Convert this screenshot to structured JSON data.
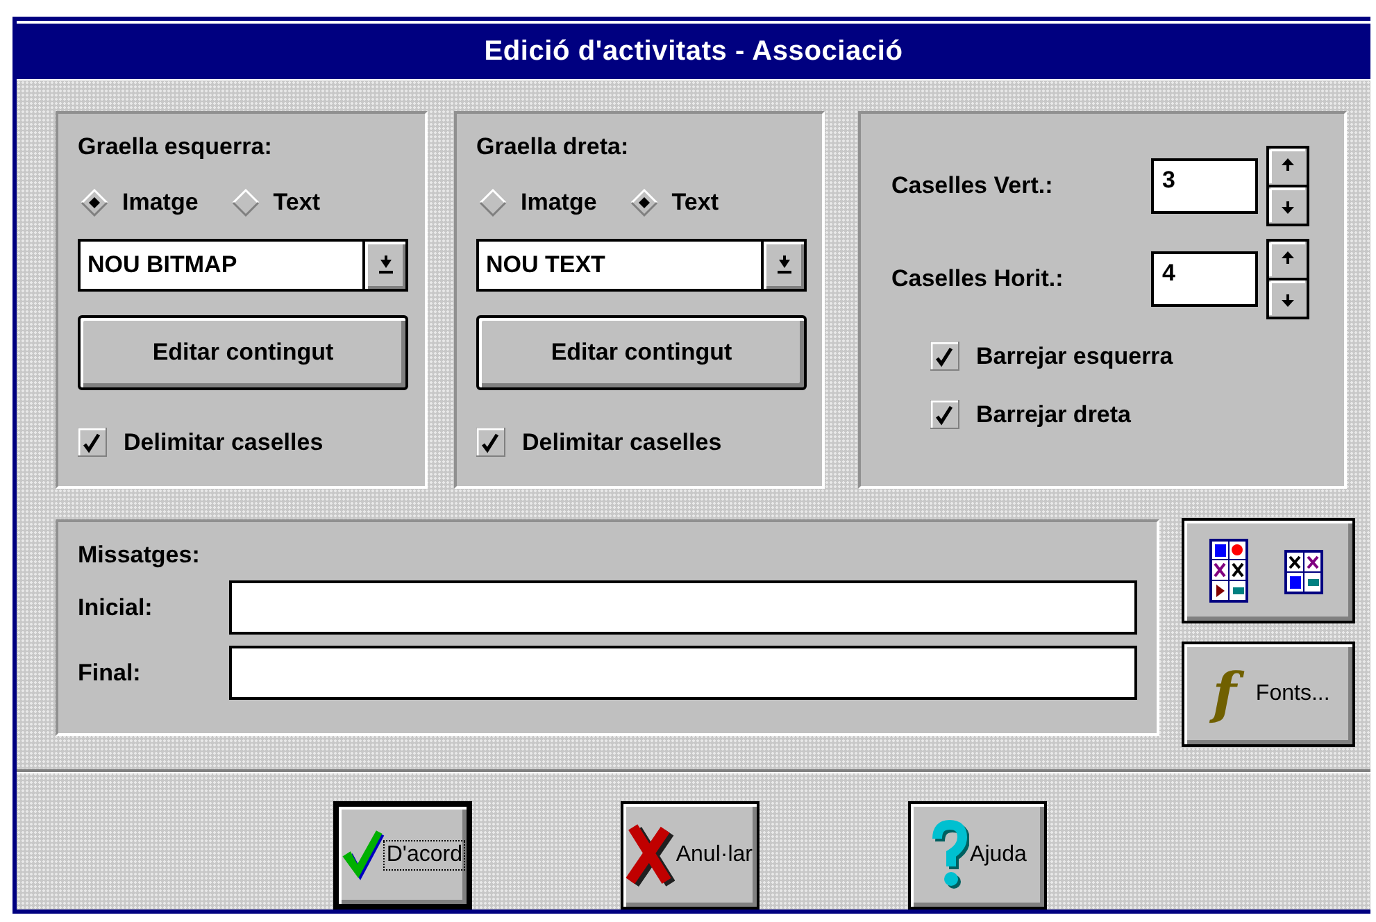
{
  "window": {
    "title": "Edició d'activitats - Associació"
  },
  "grids": [
    {
      "heading": "Graella esquerra:",
      "options": [
        {
          "label": "Imatge",
          "selected": true
        },
        {
          "label": "Text",
          "selected": false
        }
      ],
      "combo": {
        "value": "NOU BITMAP"
      },
      "edit_button": "Editar contingut",
      "delimit": {
        "label": "Delimitar caselles",
        "checked": true
      }
    },
    {
      "heading": "Graella dreta:",
      "options": [
        {
          "label": "Imatge",
          "selected": false
        },
        {
          "label": "Text",
          "selected": true
        }
      ],
      "combo": {
        "value": "NOU TEXT"
      },
      "edit_button": "Editar contingut",
      "delimit": {
        "label": "Delimitar caselles",
        "checked": true
      }
    }
  ],
  "layout": {
    "fields": [
      {
        "label": "Caselles Vert.:",
        "value": "3"
      },
      {
        "label": "Caselles Horit.:",
        "value": "4"
      }
    ],
    "options": [
      {
        "label": "Barrejar esquerra",
        "checked": true
      },
      {
        "label": "Barrejar dreta",
        "checked": true
      }
    ]
  },
  "messages": {
    "heading": "Missatges:",
    "fields": [
      {
        "label": "Inicial:"
      },
      {
        "label": "Final:"
      }
    ]
  },
  "fonts_button": {
    "icon": "f",
    "label": "Fonts..."
  },
  "buttons": [
    {
      "kind": "ok",
      "label": "D'acord",
      "default": true
    },
    {
      "kind": "cancel",
      "label": "Anul·lar",
      "default": false
    },
    {
      "kind": "help",
      "label": "Ajuda",
      "default": false
    }
  ]
}
